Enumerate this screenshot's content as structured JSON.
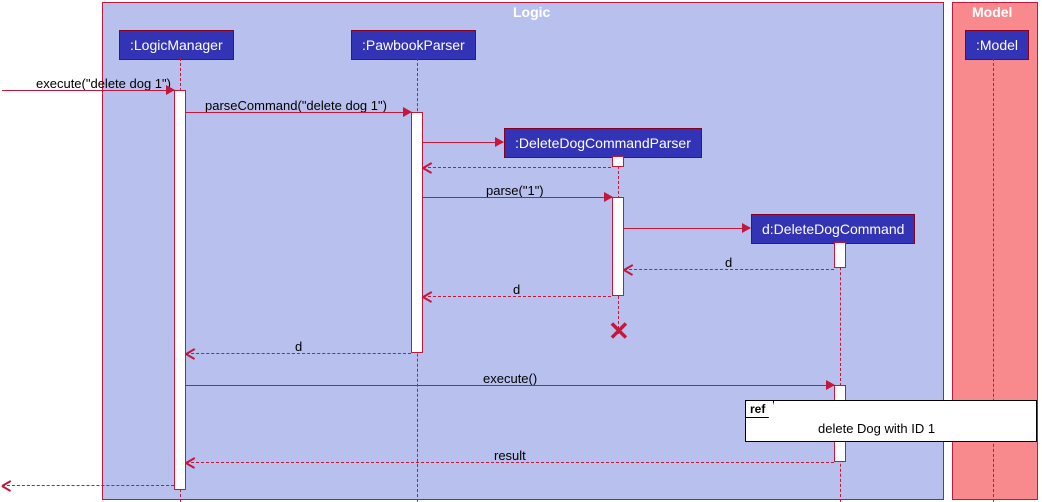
{
  "boxes": {
    "logic": "Logic",
    "model": "Model"
  },
  "participants": {
    "logicManager": ":LogicManager",
    "pawbookParser": ":PawbookParser",
    "deleteDogCommandParser": ":DeleteDogCommandParser",
    "deleteDogCommand": "d:DeleteDogCommand",
    "model": ":Model"
  },
  "messages": {
    "execute1": "execute(\"delete dog 1\")",
    "parseCommand": "parseCommand(\"delete dog 1\")",
    "parse": "parse(\"1\")",
    "d1": "d",
    "d2": "d",
    "d3": "d",
    "execute2": "execute()",
    "result": "result"
  },
  "ref": {
    "tag": "ref",
    "text": "delete Dog with ID 1"
  }
}
